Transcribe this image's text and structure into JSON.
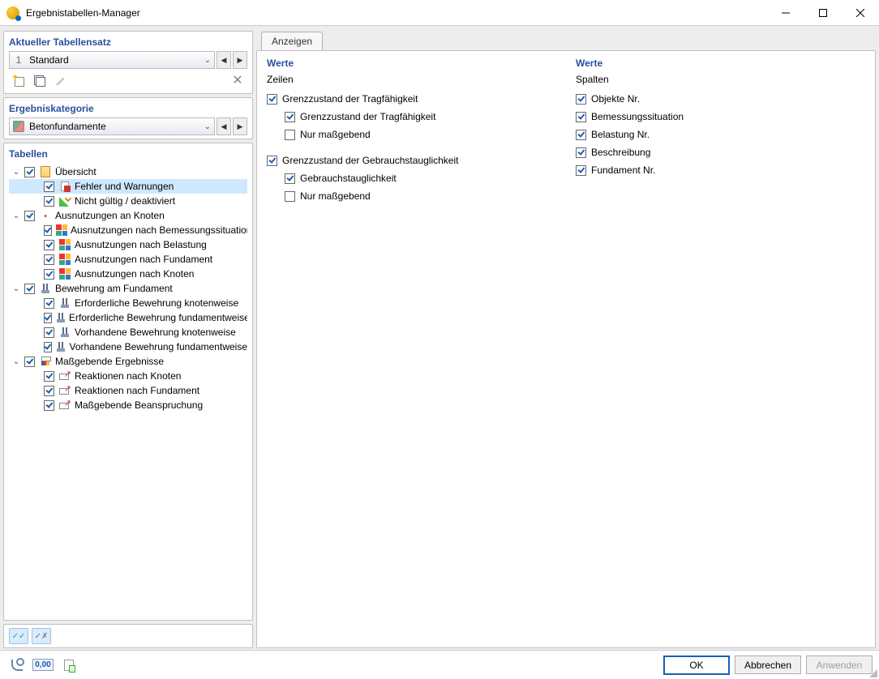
{
  "window": {
    "title": "Ergebnistabellen-Manager"
  },
  "left": {
    "tableset": {
      "header": "Aktueller Tabellensatz",
      "combo_num": "1",
      "combo_label": "Standard"
    },
    "category": {
      "header": "Ergebniskategorie",
      "combo_label": "Betonfundamente"
    },
    "tables": {
      "header": "Tabellen",
      "groups": [
        {
          "label": "Übersicht",
          "items": [
            {
              "label": "Fehler und Warnungen",
              "selected": true,
              "icon": "error"
            },
            {
              "label": "Nicht gültig / deaktiviert",
              "icon": "invalid"
            }
          ],
          "icon": "overview"
        },
        {
          "label": "Ausnutzungen an Knoten",
          "items": [
            {
              "label": "Ausnutzungen nach Bemessungssituation",
              "icon": "util"
            },
            {
              "label": "Ausnutzungen nach Belastung",
              "icon": "util"
            },
            {
              "label": "Ausnutzungen nach Fundament",
              "icon": "util"
            },
            {
              "label": "Ausnutzungen nach Knoten",
              "icon": "util"
            }
          ],
          "icon": "dot"
        },
        {
          "label": "Bewehrung am Fundament",
          "items": [
            {
              "label": "Erforderliche Bewehrung knotenweise",
              "icon": "reinf"
            },
            {
              "label": "Erforderliche Bewehrung fundamentweise",
              "icon": "reinf"
            },
            {
              "label": "Vorhandene Bewehrung knotenweise",
              "icon": "reinf"
            },
            {
              "label": "Vorhandene Bewehrung fundamentweise",
              "icon": "reinf"
            }
          ],
          "icon": "reinf"
        },
        {
          "label": "Maßgebende Ergebnisse",
          "items": [
            {
              "label": "Reaktionen nach Knoten",
              "icon": "react"
            },
            {
              "label": "Reaktionen nach Fundament",
              "icon": "react"
            },
            {
              "label": "Maßgebende Beanspruchung",
              "icon": "react"
            }
          ],
          "icon": "gov"
        }
      ]
    }
  },
  "right": {
    "tab_label": "Anzeigen",
    "col1": {
      "header": "Werte",
      "sub": "Zeilen",
      "groups": [
        {
          "label": "Grenzzustand der Tragfähigkeit",
          "children": [
            {
              "label": "Grenzzustand der Tragfähigkeit",
              "checked": true
            },
            {
              "label": "Nur maßgebend",
              "checked": false
            }
          ]
        },
        {
          "label": "Grenzzustand der Gebrauchstauglichkeit",
          "children": [
            {
              "label": "Gebrauchstauglichkeit",
              "checked": true
            },
            {
              "label": "Nur maßgebend",
              "checked": false
            }
          ]
        }
      ]
    },
    "col2": {
      "header": "Werte",
      "sub": "Spalten",
      "items": [
        {
          "label": "Objekte Nr."
        },
        {
          "label": "Bemessungssituation"
        },
        {
          "label": "Belastung Nr."
        },
        {
          "label": "Beschreibung"
        },
        {
          "label": "Fundament Nr."
        }
      ]
    }
  },
  "footer": {
    "ok": "OK",
    "cancel": "Abbrechen",
    "apply": "Anwenden",
    "num_icon_text": "0,00"
  }
}
